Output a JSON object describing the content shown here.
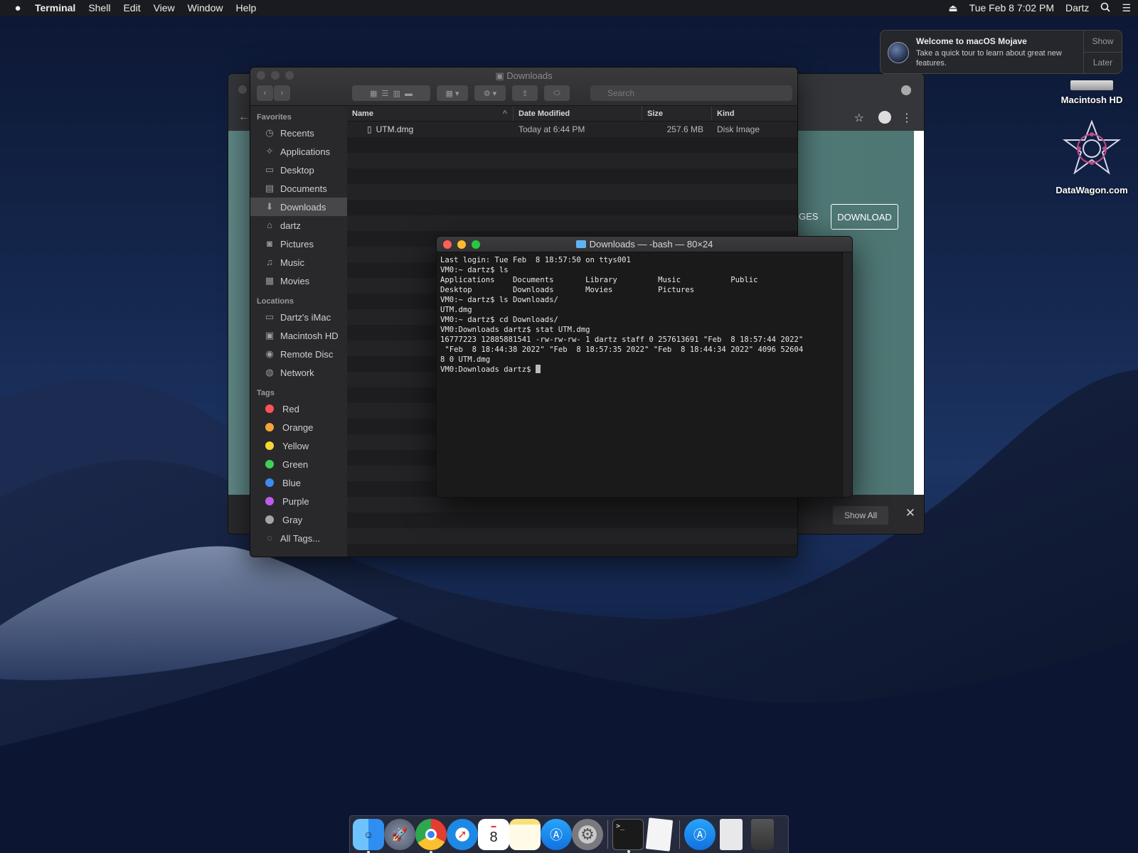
{
  "menubar": {
    "app_name": "Terminal",
    "menus": [
      "Shell",
      "Edit",
      "View",
      "Window",
      "Help"
    ],
    "datetime": "Tue Feb 8  7:02 PM",
    "user": "Dartz"
  },
  "notification": {
    "title": "Welcome to macOS Mojave",
    "description": "Take a quick tour to learn about great new features.",
    "show_label": "Show",
    "later_label": "Later"
  },
  "desktop_icons": [
    {
      "label": "Macintosh HD"
    },
    {
      "label": "DataWagon.com"
    }
  ],
  "browser": {
    "nav_fragment": "GES",
    "download_label": "DOWNLOAD",
    "show_all_label": "Show All"
  },
  "finder": {
    "title": "Downloads",
    "search_placeholder": "Search",
    "sidebar": {
      "favorites_header": "Favorites",
      "favorites": [
        {
          "label": "Recents",
          "icon": "clock-icon"
        },
        {
          "label": "Applications",
          "icon": "applications-icon"
        },
        {
          "label": "Desktop",
          "icon": "desktop-icon"
        },
        {
          "label": "Documents",
          "icon": "document-icon"
        },
        {
          "label": "Downloads",
          "icon": "download-icon"
        },
        {
          "label": "dartz",
          "icon": "home-icon"
        },
        {
          "label": "Pictures",
          "icon": "camera-icon"
        },
        {
          "label": "Music",
          "icon": "music-icon"
        },
        {
          "label": "Movies",
          "icon": "film-icon"
        }
      ],
      "locations_header": "Locations",
      "locations": [
        {
          "label": "Dartz's iMac",
          "icon": "imac-icon"
        },
        {
          "label": "Macintosh HD",
          "icon": "disk-icon"
        },
        {
          "label": "Remote Disc",
          "icon": "disc-icon"
        },
        {
          "label": "Network",
          "icon": "globe-icon"
        }
      ],
      "tags_header": "Tags",
      "tags": [
        {
          "label": "Red",
          "color": "#ff5257"
        },
        {
          "label": "Orange",
          "color": "#f7a33a"
        },
        {
          "label": "Yellow",
          "color": "#f6d636"
        },
        {
          "label": "Green",
          "color": "#3fd15a"
        },
        {
          "label": "Blue",
          "color": "#3c8cf0"
        },
        {
          "label": "Purple",
          "color": "#bf5ce8"
        },
        {
          "label": "Gray",
          "color": "#a5a5a7"
        }
      ],
      "all_tags_label": "All Tags..."
    },
    "columns": [
      "Name",
      "Date Modified",
      "Size",
      "Kind"
    ],
    "files": [
      {
        "name": "UTM.dmg",
        "date": "Today at 6:44 PM",
        "size": "257.6 MB",
        "kind": "Disk Image"
      }
    ]
  },
  "terminal": {
    "title": "Downloads — -bash — 80×24",
    "lines": [
      "Last login: Tue Feb  8 18:57:50 on ttys001",
      "VM0:~ dartz$ ls",
      "Applications    Documents       Library         Music           Public",
      "Desktop         Downloads       Movies          Pictures",
      "VM0:~ dartz$ ls Downloads/",
      "UTM.dmg",
      "VM0:~ dartz$ cd Downloads/",
      "VM0:Downloads dartz$ stat UTM.dmg",
      "16777223 12885881541 -rw-rw-rw- 1 dartz staff 0 257613691 \"Feb  8 18:57:44 2022\"",
      " \"Feb  8 18:44:38 2022\" \"Feb  8 18:57:35 2022\" \"Feb  8 18:44:34 2022\" 4096 52604",
      "8 0 UTM.dmg"
    ],
    "prompt": "VM0:Downloads dartz$ "
  },
  "dock": {
    "calendar_day": "8"
  }
}
